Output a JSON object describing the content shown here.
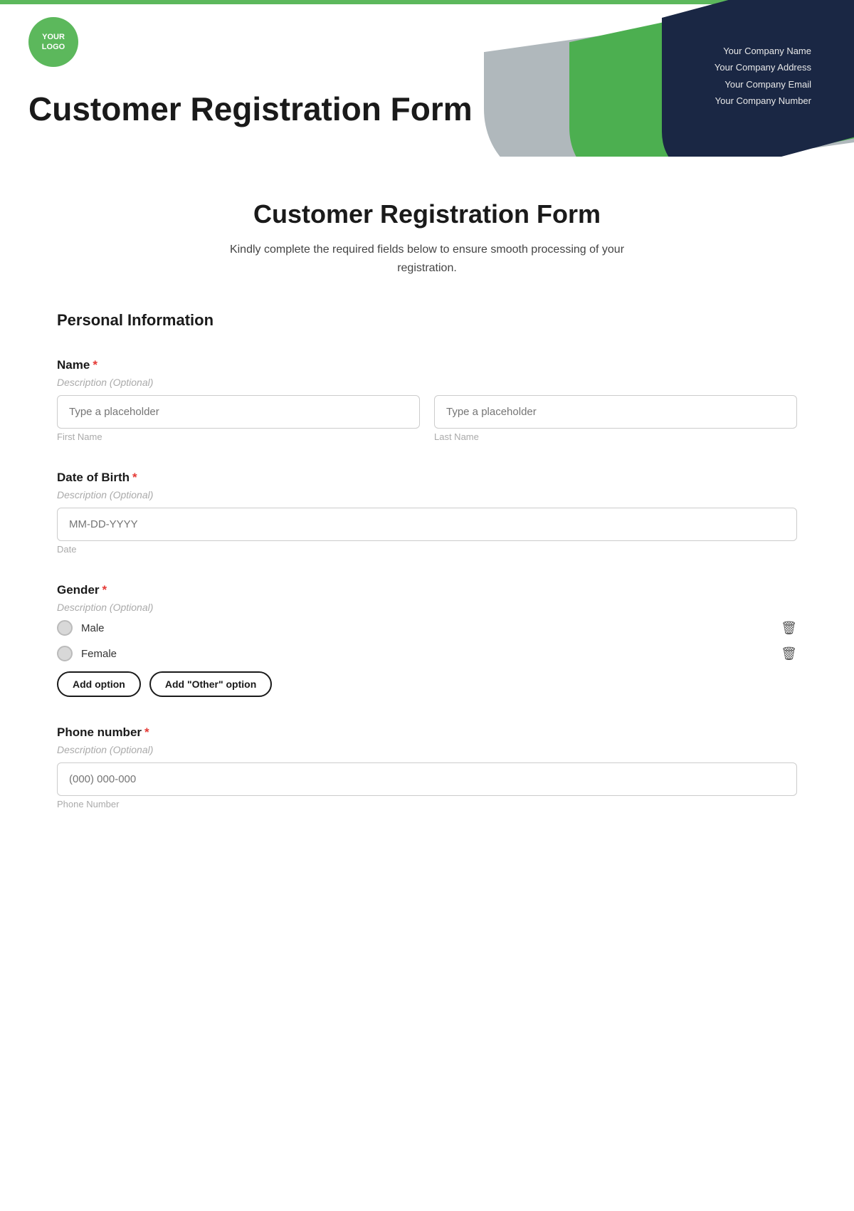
{
  "header": {
    "logo_line1": "YOUR",
    "logo_line2": "LOGO",
    "title": "Customer Registration Form",
    "company_name": "Your Company Name",
    "company_address": "Your Company Address",
    "company_email": "Your Company Email",
    "company_number": "Your Company Number"
  },
  "form": {
    "title": "Customer Registration Form",
    "subtitle": "Kindly complete the required fields below to ensure smooth processing of your registration.",
    "section_personal": "Personal Information",
    "fields": {
      "name": {
        "label": "Name",
        "required": "*",
        "description": "Description (Optional)",
        "first_placeholder": "Type a placeholder",
        "last_placeholder": "Type a placeholder",
        "first_sublabel": "First Name",
        "last_sublabel": "Last Name"
      },
      "dob": {
        "label": "Date of Birth",
        "required": "*",
        "description": "Description (Optional)",
        "placeholder": "MM-DD-YYYY",
        "sublabel": "Date"
      },
      "gender": {
        "label": "Gender",
        "required": "*",
        "description": "Description (Optional)",
        "options": [
          "Male",
          "Female"
        ],
        "add_option_label": "Add option",
        "add_other_label": "Add \"Other\" option"
      },
      "phone": {
        "label": "Phone number",
        "required": "*",
        "description": "Description (Optional)",
        "placeholder": "(000) 000-000",
        "sublabel": "Phone Number"
      }
    }
  }
}
